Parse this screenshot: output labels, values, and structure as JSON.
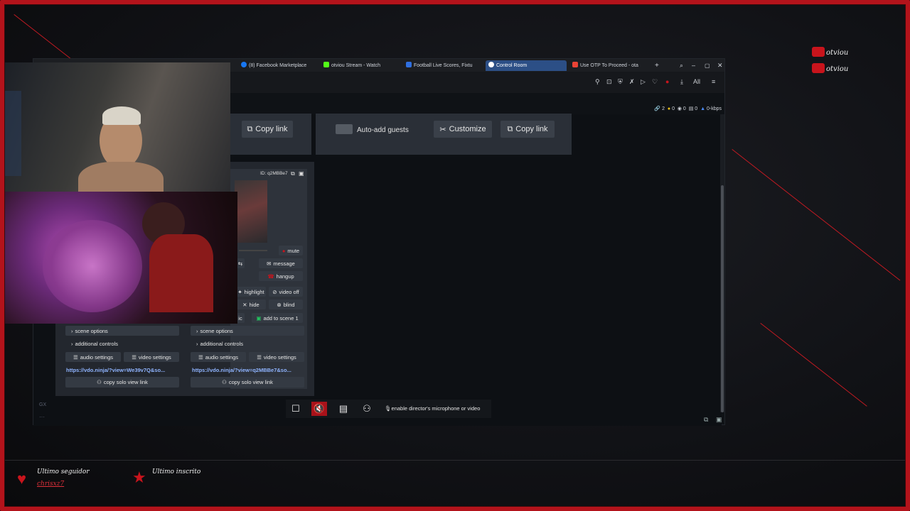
{
  "browser": {
    "tabs": [
      {
        "label": "(8) Facebook Marketplace",
        "icon": "facebook-icon",
        "color": "#1877f2"
      },
      {
        "label": "otviou Stream - Watch",
        "icon": "kick-icon",
        "color": "#53fc18"
      },
      {
        "label": "Football Live Scores, Fixtu",
        "icon": "scores-icon",
        "color": "#2f6fe0"
      },
      {
        "label": "Control Room",
        "icon": "vdo-icon",
        "color": "#ffffff",
        "active": true
      },
      {
        "label": "Use OTP To Proceed - ota",
        "icon": "gmail-icon",
        "color": "#ea4335"
      }
    ],
    "toolbar_right": "All",
    "status": {
      "links": "2",
      "bulbs": "0",
      "mics": "0",
      "cams": "0",
      "rate": "0-kbps"
    }
  },
  "room": {
    "copy_link_left": "Copy link",
    "auto_add": "Auto-add guests",
    "customize": "Customize",
    "copy_link_right": "Copy link"
  },
  "guest1": {
    "id_label": "ID: q2MBBe7",
    "mute": "mute",
    "message": "message",
    "hangup": "hangup",
    "highlight": "highlight",
    "video_off": "video off",
    "hide": "hide",
    "blind": "blind",
    "mic_prefix": "ic",
    "add_to_scene": "add to scene 1",
    "scene_options": "scene options",
    "additional_controls": "additional controls",
    "audio_settings": "audio settings",
    "video_settings": "video settings",
    "link": "https://vdo.ninja/?view=q2MBBe7&so...",
    "copy_solo": "copy solo view link"
  },
  "guest0": {
    "scene_options": "scene options",
    "additional_controls": "additional controls",
    "audio_settings": "audio settings",
    "video_settings": "video settings",
    "link": "https://vdo.ninja/?view=We39v7Q&so...",
    "copy_solo": "copy solo view link"
  },
  "director_bar": {
    "mic_text": "enable director's microphone or video"
  },
  "overlay": {
    "twitch_name": "otviou",
    "youtube_name": "otviou",
    "last_follower_title": "Ultimo seguidor",
    "last_follower_name": "chrisxz7",
    "last_sub_title": "Ultimo inscrito",
    "accent": "#c8141c"
  },
  "sidebar_tag": "GX"
}
